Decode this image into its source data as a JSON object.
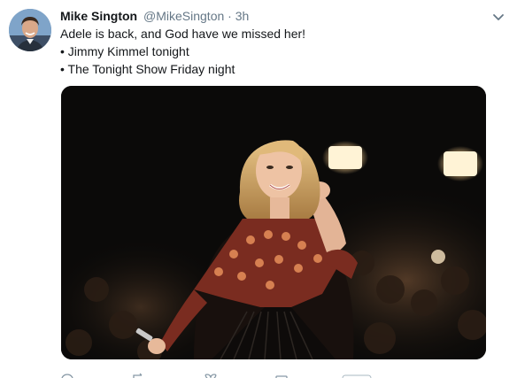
{
  "tweet": {
    "author_name": "Mike Sington",
    "handle": "@MikeSington",
    "separator": "·",
    "time": "3h",
    "lines": [
      "Adele is back, and God have we missed her!",
      "• Jimmy Kimmel tonight",
      "• The Tonight Show Friday night"
    ]
  },
  "icons": {
    "avatar": "avatar",
    "more": "chevron-down-icon",
    "reply": "reply-icon",
    "retweet": "retweet-icon",
    "like": "heart-icon",
    "message": "message-icon",
    "analytics": "analytics-badge"
  },
  "colors": {
    "text": "#14171a",
    "secondary": "#657786",
    "media_background": "#0a0908"
  }
}
